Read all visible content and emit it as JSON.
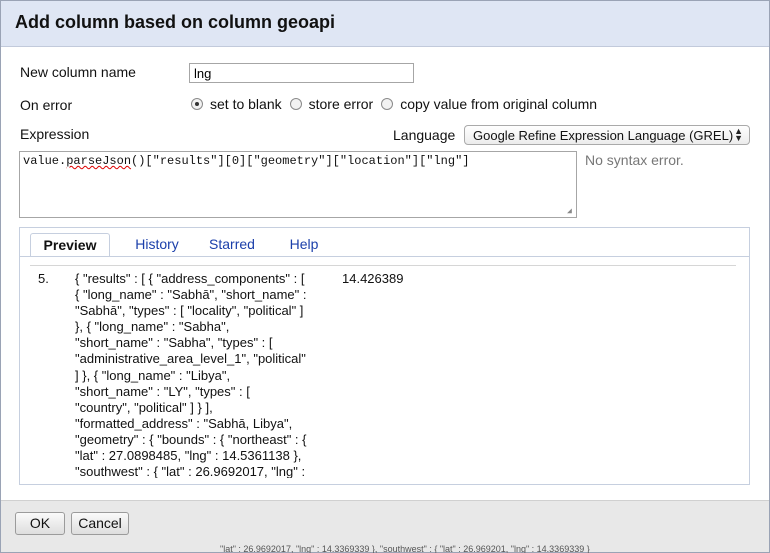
{
  "dialog": {
    "title": "Add column based on column geoapi"
  },
  "form": {
    "new_column_label": "New column name",
    "new_column_value": "lng",
    "on_error_label": "On error",
    "on_error_options": [
      "set to blank",
      "store error",
      "copy value from original column"
    ],
    "on_error_selected": "set to blank",
    "expression_label": "Expression",
    "language_label": "Language",
    "language_value": "Google Refine Expression Language (GREL)",
    "expression_code_pre": "value.",
    "expression_code_fn": "parseJson",
    "expression_code_post": "()[\"results\"][0][\"geometry\"][\"location\"][\"lng\"]",
    "syntax_status": "No syntax error."
  },
  "tabs": [
    {
      "label": "Preview",
      "active": true
    },
    {
      "label": "History",
      "active": false
    },
    {
      "label": "Starred",
      "active": false
    },
    {
      "label": "Help",
      "active": false
    }
  ],
  "preview": {
    "row_number": "5.",
    "value_lines": [
      "{ \"results\" : [ { \"address_components\" : [",
      "{ \"long_name\" : \"Sabhā\", \"short_name\" :",
      "\"Sabhā\", \"types\" : [ \"locality\", \"political\" ]",
      "}, { \"long_name\" : \"Sabha\",",
      "\"short_name\" : \"Sabha\", \"types\" : [",
      "\"administrative_area_level_1\", \"political\"",
      "] }, { \"long_name\" : \"Libya\",",
      "\"short_name\" : \"LY\", \"types\" : [",
      "\"country\", \"political\" ] } ],",
      "\"formatted_address\" : \"Sabhā, Libya\",",
      "\"geometry\" : { \"bounds\" : { \"northeast\" : {",
      "\"lat\" : 27.0898485, \"lng\" : 14.5361138 },",
      "\"southwest\" : { \"lat\" : 26.9692017, \"lng\" :"
    ],
    "result": "14.426389"
  },
  "buttons": {
    "ok": "OK",
    "cancel": "Cancel"
  },
  "background_strip": "\"lat\" : 26.9692017, \"lng\" : 14.3369339 }, \"southwest\" : { \"lat\" : 26.969201, \"lng\" : 14.3369339 }"
}
